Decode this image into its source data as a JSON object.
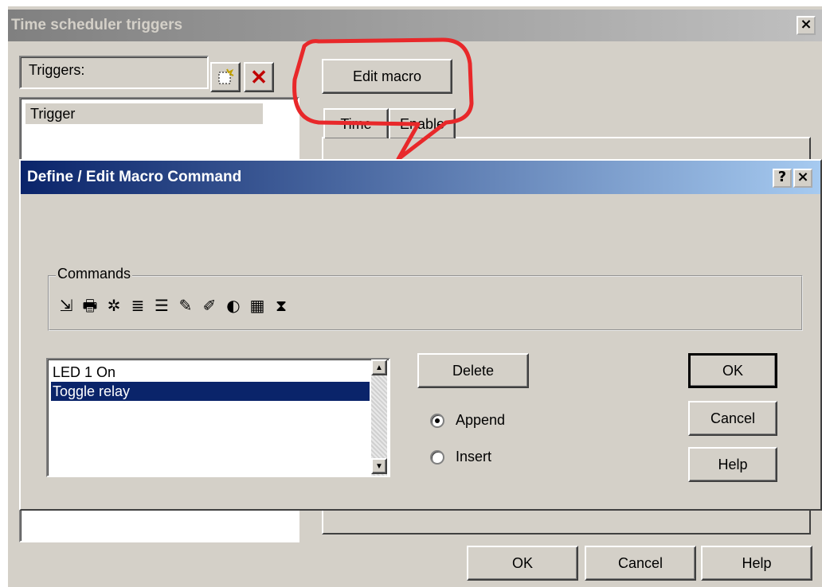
{
  "outer": {
    "title": "Time scheduler triggers",
    "close_glyph": "×",
    "triggers_label": "Triggers:",
    "new_trigger_icon": "new-icon",
    "delete_trigger_glyph": "✕",
    "trigger_items": [
      "Trigger"
    ],
    "edit_macro_label": "Edit macro",
    "tabs": [
      {
        "label": "Time"
      },
      {
        "label": "Enable"
      }
    ],
    "ok_label": "OK",
    "cancel_label": "Cancel",
    "help_label": "Help"
  },
  "callout": {
    "color": "#e8282a"
  },
  "inner": {
    "title": "Define / Edit Macro Command",
    "help_glyph": "?",
    "close_glyph": "×",
    "commands_label": "Commands",
    "command_icons": [
      {
        "name": "import-icon",
        "glyph": "⇲"
      },
      {
        "name": "print-icon",
        "glyph": "🖶"
      },
      {
        "name": "led-icon",
        "glyph": "✲"
      },
      {
        "name": "list-icon",
        "glyph": "≣"
      },
      {
        "name": "form-icon",
        "glyph": "☰"
      },
      {
        "name": "relay-icon",
        "glyph": "✎"
      },
      {
        "name": "toggle-relay-icon",
        "glyph": "✐"
      },
      {
        "name": "sound-icon",
        "glyph": "◐"
      },
      {
        "name": "display-icon",
        "glyph": "▦"
      },
      {
        "name": "hourglass-icon",
        "glyph": "⧗"
      }
    ],
    "macro_items": [
      {
        "text": "LED 1 On",
        "selected": false
      },
      {
        "text": "Toggle relay",
        "selected": true
      }
    ],
    "delete_label": "Delete",
    "append_label": "Append",
    "insert_label": "Insert",
    "mode_selected": "Append",
    "ok_label": "OK",
    "cancel_label": "Cancel",
    "help_label": "Help"
  }
}
